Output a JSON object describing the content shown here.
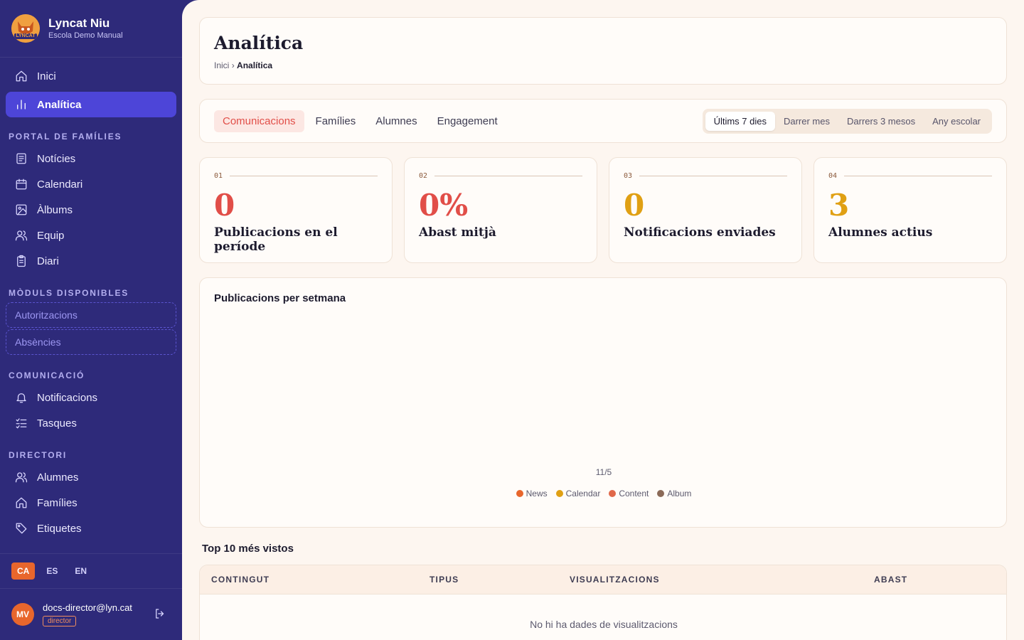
{
  "brand": {
    "name": "Lyncat Niu",
    "subtitle": "Escola Demo Manual",
    "logo_text": "LYNCAT"
  },
  "nav": {
    "top": [
      {
        "label": "Inici",
        "icon": "home-icon"
      },
      {
        "label": "Analítica",
        "icon": "bar-chart-icon",
        "active": true
      }
    ],
    "sections": {
      "portal": "PORTAL DE FAMÍLIES",
      "modules": "MÒDULS DISPONIBLES",
      "communication": "COMUNICACIÓ",
      "directory": "DIRECTORI"
    },
    "portal_items": [
      {
        "label": "Notícies",
        "icon": "newspaper-icon"
      },
      {
        "label": "Calendari",
        "icon": "calendar-icon"
      },
      {
        "label": "Àlbums",
        "icon": "image-icon"
      },
      {
        "label": "Equip",
        "icon": "users-icon"
      },
      {
        "label": "Diari",
        "icon": "clipboard-icon"
      }
    ],
    "module_items": [
      {
        "label": "Autoritzacions"
      },
      {
        "label": "Absències"
      }
    ],
    "communication_items": [
      {
        "label": "Notificacions",
        "icon": "bell-icon"
      },
      {
        "label": "Tasques",
        "icon": "checklist-icon"
      }
    ],
    "directory_items": [
      {
        "label": "Alumnes",
        "icon": "users-icon"
      },
      {
        "label": "Famílies",
        "icon": "home-icon"
      },
      {
        "label": "Etiquetes",
        "icon": "tag-icon"
      }
    ]
  },
  "languages": [
    {
      "code": "CA",
      "active": true
    },
    {
      "code": "ES"
    },
    {
      "code": "EN"
    }
  ],
  "user": {
    "initials": "MV",
    "email": "docs-director@lyn.cat",
    "role": "director"
  },
  "header": {
    "title": "Analítica",
    "breadcrumb_root": "Inici",
    "breadcrumb_sep": "›",
    "breadcrumb_current": "Analítica"
  },
  "tabs": [
    {
      "label": "Comunicacions",
      "active": true
    },
    {
      "label": "Famílies"
    },
    {
      "label": "Alumnes"
    },
    {
      "label": "Engagement"
    }
  ],
  "periods": [
    {
      "label": "Últims 7 dies",
      "active": true
    },
    {
      "label": "Darrer mes"
    },
    {
      "label": "Darrers 3 mesos"
    },
    {
      "label": "Any escolar"
    }
  ],
  "stats": [
    {
      "index": "01",
      "value": "0",
      "label": "Publicacions en el període",
      "color": "#e14e48"
    },
    {
      "index": "02",
      "value": "0%",
      "label": "Abast mitjà",
      "color": "#e14e48"
    },
    {
      "index": "03",
      "value": "0",
      "label": "Notificacions enviades",
      "color": "#e0a014"
    },
    {
      "index": "04",
      "value": "3",
      "label": "Alumnes actius",
      "color": "#e0a014"
    }
  ],
  "chart_data": {
    "type": "bar",
    "title": "Publicacions per setmana",
    "categories": [
      "11/5"
    ],
    "series": [
      {
        "name": "News",
        "values": [
          0
        ],
        "color": "#e8662c"
      },
      {
        "name": "Calendar",
        "values": [
          0
        ],
        "color": "#e0a014"
      },
      {
        "name": "Content",
        "values": [
          0
        ],
        "color": "#e0684a"
      },
      {
        "name": "Album",
        "values": [
          0
        ],
        "color": "#8b6a58"
      }
    ],
    "legend": "bottom",
    "grid": false
  },
  "top10": {
    "title": "Top 10 més vistos",
    "columns": [
      "CONTINGUT",
      "TIPUS",
      "VISUALITZACIONS",
      "ABAST"
    ],
    "empty": "No hi ha dades de visualitzacions"
  }
}
